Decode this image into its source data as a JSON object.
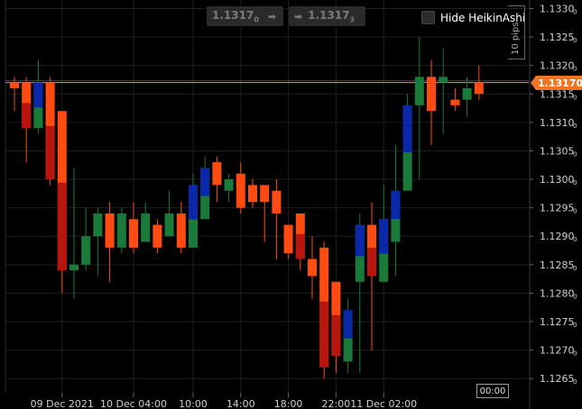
{
  "toolbar": {
    "bid_label": "1.1317",
    "bid_sub": "0",
    "ask_label": "1.1317",
    "ask_sub": "3",
    "arrow_glyph": "➡",
    "hide_heikin_ashi": "Hide HeikinAshi",
    "pips_label": "10 pips"
  },
  "price_tag": "1.13170",
  "time_cursor": "00:00",
  "colors": {
    "background": "#000000",
    "grid": "#1e1e1e",
    "bull": "#1a7a3a",
    "bull_strong": "#0a1fb8",
    "bear": "#ff4a12",
    "bear_strong": "#b01010",
    "price_line": "#c9a74a",
    "price_tag": "#f07424",
    "axis_text": "#d0d0d0"
  },
  "chart_data": {
    "type": "candlestick",
    "title": "",
    "xlabel": "",
    "ylabel": "",
    "ylim": [
      1.12625,
      1.13315
    ],
    "current_price": 1.1317,
    "y_ticks": [
      "1.1330",
      "1.1325",
      "1.1320",
      "1.1315",
      "1.1310",
      "1.1305",
      "1.1300",
      "1.1295",
      "1.1290",
      "1.1285",
      "1.1280",
      "1.1275",
      "1.1270",
      "1.1265"
    ],
    "y_tick_values": [
      1.133,
      1.1325,
      1.132,
      1.1315,
      1.131,
      1.1305,
      1.13,
      1.1295,
      1.129,
      1.1285,
      1.128,
      1.1275,
      1.127,
      1.1265
    ],
    "y_tick_subdigit": "0",
    "x_ticks": [
      "09 Dec 2021",
      "10 Dec 04:00",
      "10:00",
      "14:00",
      "18:00",
      "22:00",
      "11 Dec 02:00"
    ],
    "x_tick_bar_index": [
      4,
      10,
      15,
      19,
      23,
      27,
      31
    ],
    "candles": [
      {
        "o": 1.1317,
        "h": 1.1318,
        "l": 1.1312,
        "c": 1.1316
      },
      {
        "o": 1.1317,
        "h": 1.1318,
        "l": 1.1303,
        "c": 1.1309
      },
      {
        "o": 1.1309,
        "h": 1.1321,
        "l": 1.1308,
        "c": 1.1317
      },
      {
        "o": 1.1317,
        "h": 1.1318,
        "l": 1.1299,
        "c": 1.13
      },
      {
        "o": 1.1312,
        "h": 1.1312,
        "l": 1.128,
        "c": 1.1284
      },
      {
        "o": 1.1284,
        "h": 1.1302,
        "l": 1.1279,
        "c": 1.1285
      },
      {
        "o": 1.1285,
        "h": 1.1295,
        "l": 1.1284,
        "c": 1.129
      },
      {
        "o": 1.129,
        "h": 1.1295,
        "l": 1.1283,
        "c": 1.1294
      },
      {
        "o": 1.1294,
        "h": 1.1296,
        "l": 1.1282,
        "c": 1.1288
      },
      {
        "o": 1.1288,
        "h": 1.1295,
        "l": 1.1287,
        "c": 1.1294
      },
      {
        "o": 1.1293,
        "h": 1.1296,
        "l": 1.1287,
        "c": 1.1288
      },
      {
        "o": 1.1289,
        "h": 1.1296,
        "l": 1.1289,
        "c": 1.1294
      },
      {
        "o": 1.1292,
        "h": 1.1293,
        "l": 1.1287,
        "c": 1.1288
      },
      {
        "o": 1.129,
        "h": 1.1298,
        "l": 1.129,
        "c": 1.1294
      },
      {
        "o": 1.1294,
        "h": 1.1296,
        "l": 1.1287,
        "c": 1.1288
      },
      {
        "o": 1.1288,
        "h": 1.1301,
        "l": 1.1288,
        "c": 1.1299
      },
      {
        "o": 1.1293,
        "h": 1.1304,
        "l": 1.1293,
        "c": 1.1302
      },
      {
        "o": 1.1303,
        "h": 1.1304,
        "l": 1.1296,
        "c": 1.1299
      },
      {
        "o": 1.1298,
        "h": 1.1301,
        "l": 1.1296,
        "c": 1.13
      },
      {
        "o": 1.1301,
        "h": 1.1303,
        "l": 1.1294,
        "c": 1.1295
      },
      {
        "o": 1.1299,
        "h": 1.13,
        "l": 1.1295,
        "c": 1.1296
      },
      {
        "o": 1.1299,
        "h": 1.1299,
        "l": 1.1289,
        "c": 1.1296
      },
      {
        "o": 1.1298,
        "h": 1.13,
        "l": 1.1286,
        "c": 1.1294
      },
      {
        "o": 1.1292,
        "h": 1.1292,
        "l": 1.1286,
        "c": 1.1287
      },
      {
        "o": 1.1294,
        "h": 1.1294,
        "l": 1.1284,
        "c": 1.1286
      },
      {
        "o": 1.1286,
        "h": 1.129,
        "l": 1.1279,
        "c": 1.1283
      },
      {
        "o": 1.1288,
        "h": 1.1289,
        "l": 1.1265,
        "c": 1.1267
      },
      {
        "o": 1.1282,
        "h": 1.1282,
        "l": 1.1266,
        "c": 1.1269
      },
      {
        "o": 1.1268,
        "h": 1.1279,
        "l": 1.1266,
        "c": 1.1277
      },
      {
        "o": 1.1282,
        "h": 1.1294,
        "l": 1.1266,
        "c": 1.1292
      },
      {
        "o": 1.1292,
        "h": 1.1296,
        "l": 1.127,
        "c": 1.1283
      },
      {
        "o": 1.1282,
        "h": 1.1299,
        "l": 1.1282,
        "c": 1.1293
      },
      {
        "o": 1.1289,
        "h": 1.1306,
        "l": 1.1283,
        "c": 1.1298
      },
      {
        "o": 1.1298,
        "h": 1.1315,
        "l": 1.1298,
        "c": 1.1313
      },
      {
        "o": 1.1313,
        "h": 1.1325,
        "l": 1.13,
        "c": 1.1318
      },
      {
        "o": 1.1318,
        "h": 1.1321,
        "l": 1.1306,
        "c": 1.1312
      },
      {
        "o": 1.1317,
        "h": 1.1323,
        "l": 1.1308,
        "c": 1.1318
      },
      {
        "o": 1.1314,
        "h": 1.1316,
        "l": 1.1312,
        "c": 1.1313
      },
      {
        "o": 1.1314,
        "h": 1.1318,
        "l": 1.1311,
        "c": 1.1316
      },
      {
        "o": 1.1317,
        "h": 1.132,
        "l": 1.1314,
        "c": 1.1315
      }
    ]
  }
}
